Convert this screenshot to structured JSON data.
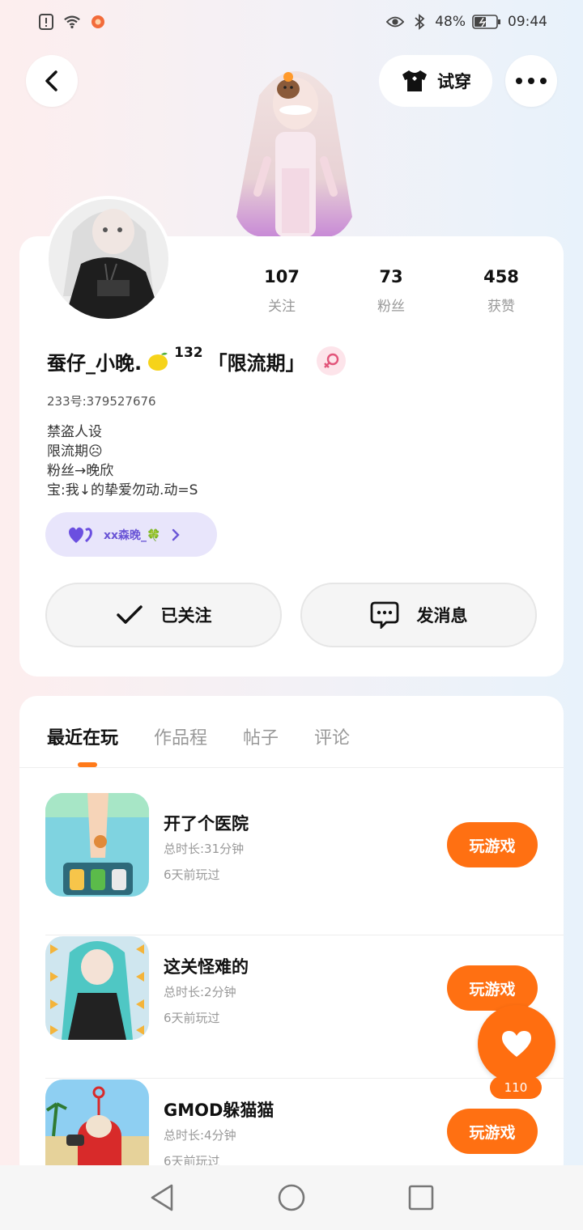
{
  "status_bar": {
    "battery": "48%",
    "time": "09:44",
    "icons": [
      "sim-alert-icon",
      "wifi-icon",
      "notification-app-icon",
      "eye-icon",
      "bluetooth-icon",
      "battery-icon"
    ]
  },
  "header": {
    "back_icon": "back-arrow-icon",
    "try_on_label": "试穿",
    "try_on_icon": "tshirt-icon",
    "more_icon": "more-dots-icon"
  },
  "profile": {
    "stats": [
      {
        "value": "107",
        "label": "关注"
      },
      {
        "value": "73",
        "label": "粉丝"
      },
      {
        "value": "458",
        "label": "获赞"
      }
    ],
    "username_pre": "蚕仔_小晚.",
    "level": "132",
    "username_post": "「限流期」",
    "uid": "233号:379527676",
    "bio": [
      "禁盗人设",
      "限流期☹",
      "粉丝→晚欣",
      "宝:我↓的挚爱勿动.动=S"
    ],
    "cp_name": "xx森晚_🍀",
    "follow_label": "已关注",
    "message_label": "发消息"
  },
  "tabs": [
    {
      "label": "最近在玩",
      "active": true
    },
    {
      "label": "作品程",
      "active": false
    },
    {
      "label": "帖子",
      "active": false
    },
    {
      "label": "评论",
      "active": false
    }
  ],
  "games": [
    {
      "name": "开了个医院",
      "duration": "总时长:31分钟",
      "last_played": "6天前玩过",
      "button": "玩游戏"
    },
    {
      "name": "这关怪难的",
      "duration": "总时长:2分钟",
      "last_played": "6天前玩过",
      "button": "玩游戏"
    },
    {
      "name": "GMOD躲猫猫",
      "duration": "总时长:4分钟",
      "last_played": "6天前玩过",
      "button": "玩游戏"
    }
  ],
  "like_fab": {
    "count": "110"
  },
  "colors": {
    "accent": "#ff7012",
    "cp_pill": "#e8e5fb",
    "gender_bg": "#fde4ea"
  }
}
